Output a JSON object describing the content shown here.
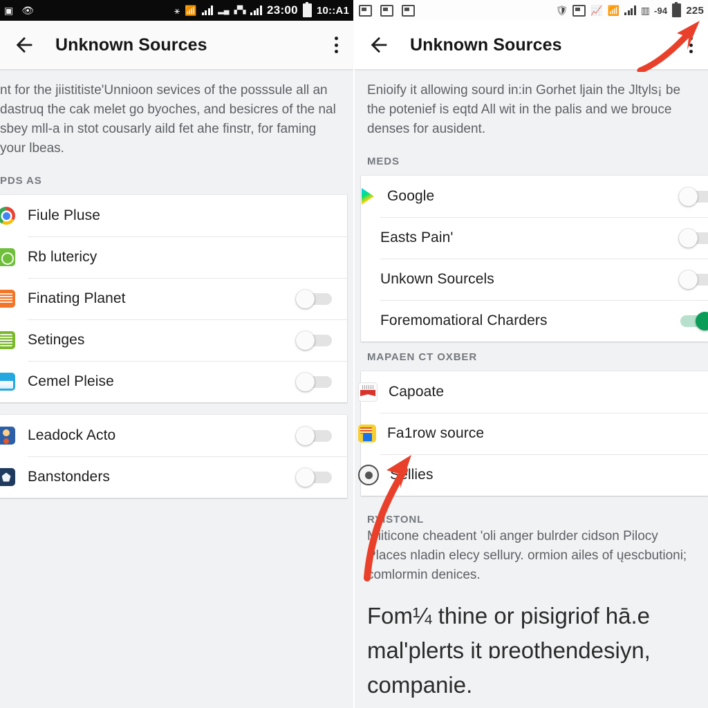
{
  "left_panel": {
    "statusbar": {
      "time": "23:00",
      "secondary": "10::A1",
      "icons_left": [
        "photo-icon",
        "eye-icon"
      ],
      "icons_right": [
        "bluetooth-icon",
        "wifi-icon",
        "signal-icon",
        "signal-2-icon",
        "signal-3-icon",
        "signal-4-icon"
      ],
      "background": "#0a0a0a"
    },
    "appbar": {
      "back_label": "back-arrow",
      "title": "Unknown Sources",
      "overflow_label": "more-options"
    },
    "description": "nt for the jiistitiste'Unnioon sevices of the posssule all an dastruq the cak melet go byoches, and besicres of the nal sbey mll-a in stot cousarly aild fet ahe finstr, for faming your lbeas.",
    "section_header": "PDS AS",
    "group_one": [
      {
        "icon": "chrome-icon",
        "icon_class": "ic-chrome",
        "label": "Fiule Pluse",
        "toggle": null
      },
      {
        "icon": "green-circle-app-icon",
        "icon_class": "ic-green",
        "label": "Rb lutericy",
        "toggle": null
      },
      {
        "icon": "orange-app-icon",
        "icon_class": "ic-orange",
        "label": "Finating Planet",
        "toggle": "off"
      },
      {
        "icon": "lime-notes-icon",
        "icon_class": "ic-lgreen",
        "label": "Setinges",
        "toggle": "off"
      },
      {
        "icon": "blue-news-icon",
        "icon_class": "ic-blue",
        "label": "Cemel Pleise",
        "toggle": "off"
      }
    ],
    "group_two": [
      {
        "icon": "person-app-icon",
        "icon_class": "ic-person",
        "label": "Leadock Acto",
        "toggle": "off"
      },
      {
        "icon": "dark-blue-app-icon",
        "icon_class": "ic-dark",
        "label": "Banstonders",
        "toggle": "off"
      }
    ]
  },
  "right_panel": {
    "statusbar": {
      "icons_left": [
        "screenshot-icon",
        "sim-card-icon",
        "message-icon"
      ],
      "icons_right": [
        "shield-icon",
        "info-icon",
        "chart-icon",
        "wifi-icon",
        "signal-icon",
        "bars-icon"
      ],
      "label_1": "-94",
      "battery_text": "225",
      "background": "#fdfdfd"
    },
    "appbar": {
      "back_label": "back-arrow",
      "title": "Unknown Sources",
      "overflow_label": "more-options"
    },
    "description": "Enioify it allowing sourd in:in Gorhet ljain the Jltyls¡ be the potenief is eqtd All wit in the palis and we brouce denses for ausident.",
    "section_header_1": "MEDS",
    "group_one": [
      {
        "icon": "google-play-icon",
        "icon_class": "ic-play",
        "label": "Google",
        "toggle": "off",
        "has_icon": true
      },
      {
        "icon": null,
        "icon_class": "",
        "label": "Easts Pain'",
        "toggle": "off",
        "has_icon": false
      },
      {
        "icon": null,
        "icon_class": "",
        "label": "Unkown Sourcels",
        "toggle": "off",
        "has_icon": false
      },
      {
        "icon": null,
        "icon_class": "",
        "label": "Foremomatioral Charders",
        "toggle": "on",
        "has_icon": false
      }
    ],
    "section_header_2": "MAPAEN CT OXBER",
    "group_two": [
      {
        "icon": "red-note-icon",
        "icon_class": "ic-red-note",
        "label": "Capoate",
        "toggle": null,
        "has_icon": true
      },
      {
        "icon": "yellow-news-icon",
        "icon_class": "ic-yellow",
        "label": "Fa1row source",
        "toggle": null,
        "has_icon": true
      },
      {
        "icon": "gray-circle-icon",
        "icon_class": "ic-gray-g",
        "label": "Sellies",
        "toggle": null,
        "has_icon": true
      }
    ],
    "footer_header": "RYISTONL",
    "footer_text": "Miiticone cheadent 'oli anger bulrder cidson Pilocy Places nladin elecy sellury. ormion ailes of ųescbutioni; comlormin denices.",
    "bottom_note": "Fom¼ thine or pisigriof hā.e mal'plerts it ɒreothendesiyn, companie."
  },
  "annotations": {
    "arrow_color": "#e8402a",
    "arrow_top": "arrow-pointing-to-overflow-menu",
    "arrow_bottom": "arrow-pointing-to-sellies-row"
  }
}
